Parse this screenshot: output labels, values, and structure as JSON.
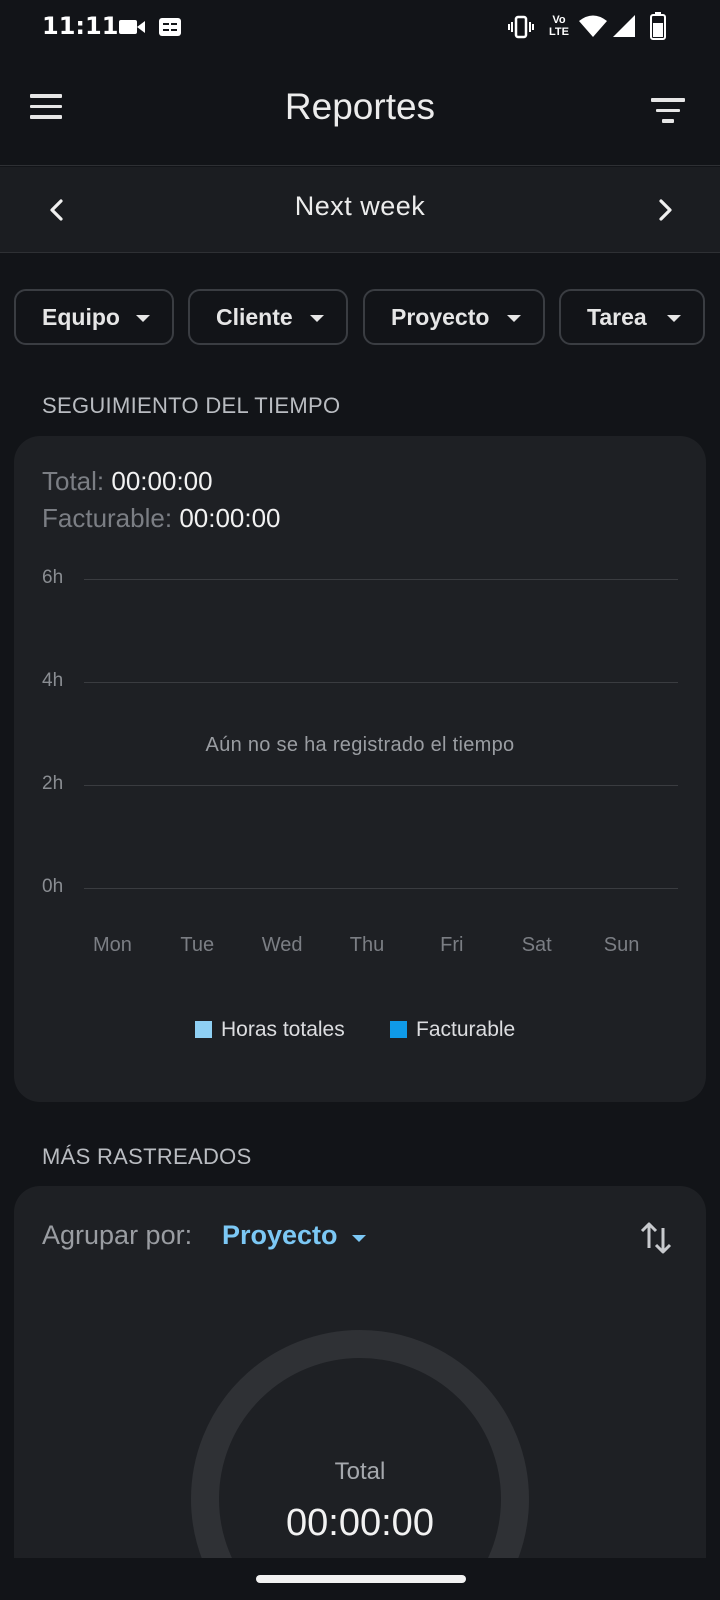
{
  "status_bar": {
    "time": "11:11",
    "left_icons": [
      "video-camera-icon",
      "ge-badge-icon"
    ],
    "right_icons": [
      "vibrate-icon",
      "volte-icon",
      "wifi-icon",
      "signal-icon",
      "battery-icon"
    ],
    "volte_text": "Vo LTE"
  },
  "app_bar": {
    "title": "Reportes",
    "menu_icon": "hamburger-menu-icon",
    "filter_icon": "filter-icon"
  },
  "week_nav": {
    "label": "Next week",
    "prev_icon": "chevron-left-icon",
    "next_icon": "chevron-right-icon"
  },
  "filters": [
    {
      "label": "Equipo"
    },
    {
      "label": "Cliente"
    },
    {
      "label": "Proyecto"
    },
    {
      "label": "Tarea"
    }
  ],
  "time_tracking": {
    "section_title": "SEGUIMIENTO DEL TIEMPO",
    "total_label": "Total:",
    "total_value": "00:00:00",
    "billable_label": "Facturable:",
    "billable_value": "00:00:00",
    "empty_message": "Aún no se ha registrado el tiempo"
  },
  "chart_data": {
    "type": "bar",
    "categories": [
      "Mon",
      "Tue",
      "Wed",
      "Thu",
      "Fri",
      "Sat",
      "Sun"
    ],
    "y_ticks": [
      "6h",
      "4h",
      "2h",
      "0h"
    ],
    "ylim": [
      0,
      6
    ],
    "series": [
      {
        "name": "Horas totales",
        "color": "#8fd0f4",
        "values": [
          0,
          0,
          0,
          0,
          0,
          0,
          0
        ]
      },
      {
        "name": "Facturable",
        "color": "#0f9ae8",
        "values": [
          0,
          0,
          0,
          0,
          0,
          0,
          0
        ]
      }
    ],
    "grid": true,
    "legend": "bottom"
  },
  "most_tracked": {
    "section_title": "MÁS RASTREADOS",
    "group_by_label": "Agrupar por:",
    "group_by_value": "Proyecto",
    "sort_icon": "sort-arrows-icon",
    "donut_label": "Total",
    "donut_value": "00:00:00"
  },
  "colors": {
    "background": "#121418",
    "card": "#1e2024",
    "accent": "#7cc8f5"
  }
}
